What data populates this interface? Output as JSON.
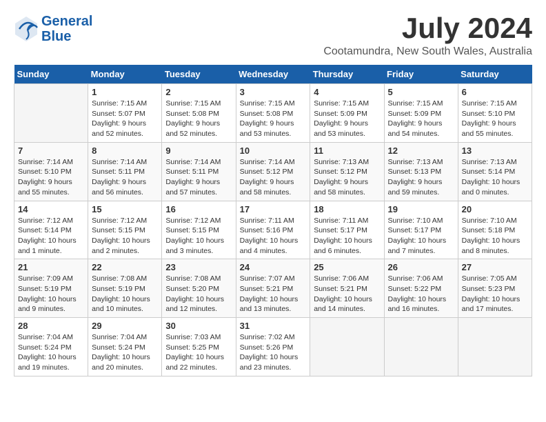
{
  "header": {
    "logo_line1": "General",
    "logo_line2": "Blue",
    "month": "July 2024",
    "location": "Cootamundra, New South Wales, Australia"
  },
  "columns": [
    "Sunday",
    "Monday",
    "Tuesday",
    "Wednesday",
    "Thursday",
    "Friday",
    "Saturday"
  ],
  "weeks": [
    [
      {
        "day": "",
        "info": ""
      },
      {
        "day": "1",
        "info": "Sunrise: 7:15 AM\nSunset: 5:07 PM\nDaylight: 9 hours\nand 52 minutes."
      },
      {
        "day": "2",
        "info": "Sunrise: 7:15 AM\nSunset: 5:08 PM\nDaylight: 9 hours\nand 52 minutes."
      },
      {
        "day": "3",
        "info": "Sunrise: 7:15 AM\nSunset: 5:08 PM\nDaylight: 9 hours\nand 53 minutes."
      },
      {
        "day": "4",
        "info": "Sunrise: 7:15 AM\nSunset: 5:09 PM\nDaylight: 9 hours\nand 53 minutes."
      },
      {
        "day": "5",
        "info": "Sunrise: 7:15 AM\nSunset: 5:09 PM\nDaylight: 9 hours\nand 54 minutes."
      },
      {
        "day": "6",
        "info": "Sunrise: 7:15 AM\nSunset: 5:10 PM\nDaylight: 9 hours\nand 55 minutes."
      }
    ],
    [
      {
        "day": "7",
        "info": "Sunrise: 7:14 AM\nSunset: 5:10 PM\nDaylight: 9 hours\nand 55 minutes."
      },
      {
        "day": "8",
        "info": "Sunrise: 7:14 AM\nSunset: 5:11 PM\nDaylight: 9 hours\nand 56 minutes."
      },
      {
        "day": "9",
        "info": "Sunrise: 7:14 AM\nSunset: 5:11 PM\nDaylight: 9 hours\nand 57 minutes."
      },
      {
        "day": "10",
        "info": "Sunrise: 7:14 AM\nSunset: 5:12 PM\nDaylight: 9 hours\nand 58 minutes."
      },
      {
        "day": "11",
        "info": "Sunrise: 7:13 AM\nSunset: 5:12 PM\nDaylight: 9 hours\nand 58 minutes."
      },
      {
        "day": "12",
        "info": "Sunrise: 7:13 AM\nSunset: 5:13 PM\nDaylight: 9 hours\nand 59 minutes."
      },
      {
        "day": "13",
        "info": "Sunrise: 7:13 AM\nSunset: 5:14 PM\nDaylight: 10 hours\nand 0 minutes."
      }
    ],
    [
      {
        "day": "14",
        "info": "Sunrise: 7:12 AM\nSunset: 5:14 PM\nDaylight: 10 hours\nand 1 minute."
      },
      {
        "day": "15",
        "info": "Sunrise: 7:12 AM\nSunset: 5:15 PM\nDaylight: 10 hours\nand 2 minutes."
      },
      {
        "day": "16",
        "info": "Sunrise: 7:12 AM\nSunset: 5:15 PM\nDaylight: 10 hours\nand 3 minutes."
      },
      {
        "day": "17",
        "info": "Sunrise: 7:11 AM\nSunset: 5:16 PM\nDaylight: 10 hours\nand 4 minutes."
      },
      {
        "day": "18",
        "info": "Sunrise: 7:11 AM\nSunset: 5:17 PM\nDaylight: 10 hours\nand 6 minutes."
      },
      {
        "day": "19",
        "info": "Sunrise: 7:10 AM\nSunset: 5:17 PM\nDaylight: 10 hours\nand 7 minutes."
      },
      {
        "day": "20",
        "info": "Sunrise: 7:10 AM\nSunset: 5:18 PM\nDaylight: 10 hours\nand 8 minutes."
      }
    ],
    [
      {
        "day": "21",
        "info": "Sunrise: 7:09 AM\nSunset: 5:19 PM\nDaylight: 10 hours\nand 9 minutes."
      },
      {
        "day": "22",
        "info": "Sunrise: 7:08 AM\nSunset: 5:19 PM\nDaylight: 10 hours\nand 10 minutes."
      },
      {
        "day": "23",
        "info": "Sunrise: 7:08 AM\nSunset: 5:20 PM\nDaylight: 10 hours\nand 12 minutes."
      },
      {
        "day": "24",
        "info": "Sunrise: 7:07 AM\nSunset: 5:21 PM\nDaylight: 10 hours\nand 13 minutes."
      },
      {
        "day": "25",
        "info": "Sunrise: 7:06 AM\nSunset: 5:21 PM\nDaylight: 10 hours\nand 14 minutes."
      },
      {
        "day": "26",
        "info": "Sunrise: 7:06 AM\nSunset: 5:22 PM\nDaylight: 10 hours\nand 16 minutes."
      },
      {
        "day": "27",
        "info": "Sunrise: 7:05 AM\nSunset: 5:23 PM\nDaylight: 10 hours\nand 17 minutes."
      }
    ],
    [
      {
        "day": "28",
        "info": "Sunrise: 7:04 AM\nSunset: 5:24 PM\nDaylight: 10 hours\nand 19 minutes."
      },
      {
        "day": "29",
        "info": "Sunrise: 7:04 AM\nSunset: 5:24 PM\nDaylight: 10 hours\nand 20 minutes."
      },
      {
        "day": "30",
        "info": "Sunrise: 7:03 AM\nSunset: 5:25 PM\nDaylight: 10 hours\nand 22 minutes."
      },
      {
        "day": "31",
        "info": "Sunrise: 7:02 AM\nSunset: 5:26 PM\nDaylight: 10 hours\nand 23 minutes."
      },
      {
        "day": "",
        "info": ""
      },
      {
        "day": "",
        "info": ""
      },
      {
        "day": "",
        "info": ""
      }
    ]
  ]
}
